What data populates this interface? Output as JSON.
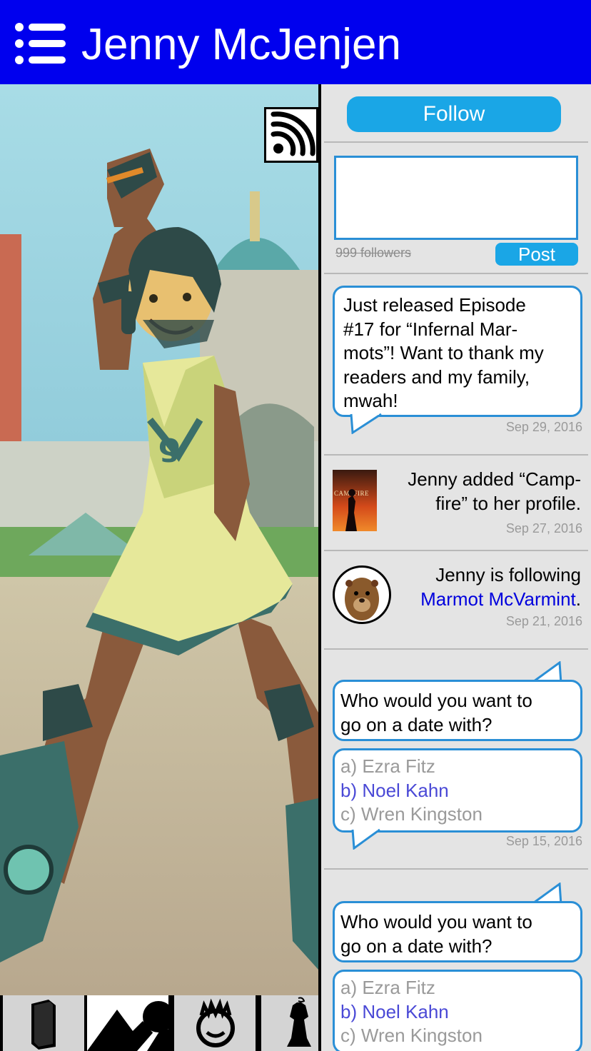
{
  "header": {
    "title": "Jenny McJenjen",
    "menu_icon": "menu-icon"
  },
  "art": {
    "rss_icon": "rss-icon"
  },
  "tabs": [
    {
      "icon": "book-icon",
      "active": false
    },
    {
      "icon": "mountain-icon",
      "active": true
    },
    {
      "icon": "face-icon",
      "active": false
    },
    {
      "icon": "dress-icon",
      "active": false
    }
  ],
  "feed": {
    "follow_label": "Follow",
    "post_placeholder": "",
    "followers_text": "999 followers",
    "post_label": "Post",
    "items": [
      {
        "type": "status",
        "lines": [
          "Just released Episode",
          "#17 for “Infernal Mar-",
          "mots”! Want to thank my",
          "readers and my family,",
          "mwah!"
        ],
        "date": "Sep 29, 2016"
      },
      {
        "type": "activity",
        "thumb_text": "CAMPFIRE",
        "lines": [
          "Jenny added “Camp-",
          "fire” to her profile."
        ],
        "date": "Sep 27, 2016"
      },
      {
        "type": "activity",
        "line1": "Jenny is following",
        "link": "Marmot McVarmint",
        "link_suffix": ".",
        "date": "Sep 21, 2016",
        "avatar_icon": "marmot-avatar"
      },
      {
        "type": "poll",
        "question": [
          "Who would you want to",
          "go on a date with?"
        ],
        "options": [
          "a) Ezra Fitz",
          "b) Noel Kahn",
          "c) Wren Kingston"
        ],
        "selected": 1,
        "date": "Sep 15, 2016"
      },
      {
        "type": "poll",
        "question": [
          "Who would you want to",
          "go on a date with?"
        ],
        "options": [
          "a) Ezra Fitz",
          "b) Noel Kahn",
          "c) Wren Kingston"
        ],
        "selected": 1
      }
    ]
  },
  "colors": {
    "header": "#0000ee",
    "accent": "#1aa6e6",
    "bubble_border": "#2a8fd6",
    "link": "#0000dd",
    "selected_option": "#4a49d6"
  }
}
